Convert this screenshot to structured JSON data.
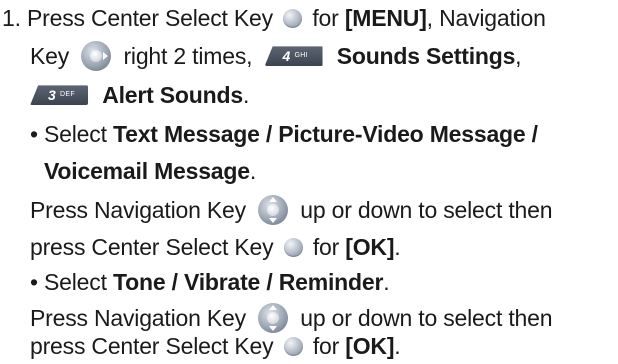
{
  "step": {
    "number": "1.",
    "press_center_select_key": "Press Center Select Key",
    "for": "for",
    "menu": "[MENU]",
    "comma1": ",",
    "navigation_key": "Navigation",
    "key_word": "Key",
    "right_2_times": "right 2 times,",
    "key4_num": "4",
    "key4_letters": "GHI",
    "sounds_settings": "Sounds Settings",
    "comma2": ",",
    "key3_num": "3",
    "key3_letters": "DEF",
    "alert_sounds": "Alert Sounds",
    "period": "."
  },
  "bullets": [
    {
      "select_word": "• Select",
      "options": "Text Message / Picture-Video Message /",
      "options_cont": "Voicemail Message",
      "options_end": ".",
      "press_nav": "Press Navigation Key",
      "up_down": "up or down to select then",
      "press_center": "press Center Select Key",
      "for": "for",
      "ok": "[OK]",
      "end": "."
    },
    {
      "select_word": "• Select",
      "options": "Tone / Vibrate / Reminder",
      "options_end": ".",
      "press_nav": "Press Navigation Key",
      "up_down": "up or down to select then",
      "press_center": "press Center Select Key",
      "for": "for",
      "ok": "[OK]",
      "end": "."
    }
  ],
  "icons": {
    "center_select": "center-select-key-icon",
    "nav_right": "navigation-key-right-icon",
    "nav_updown": "navigation-key-up-down-icon",
    "key4": "keypad-4-ghi-icon",
    "key3": "keypad-3-def-icon"
  }
}
